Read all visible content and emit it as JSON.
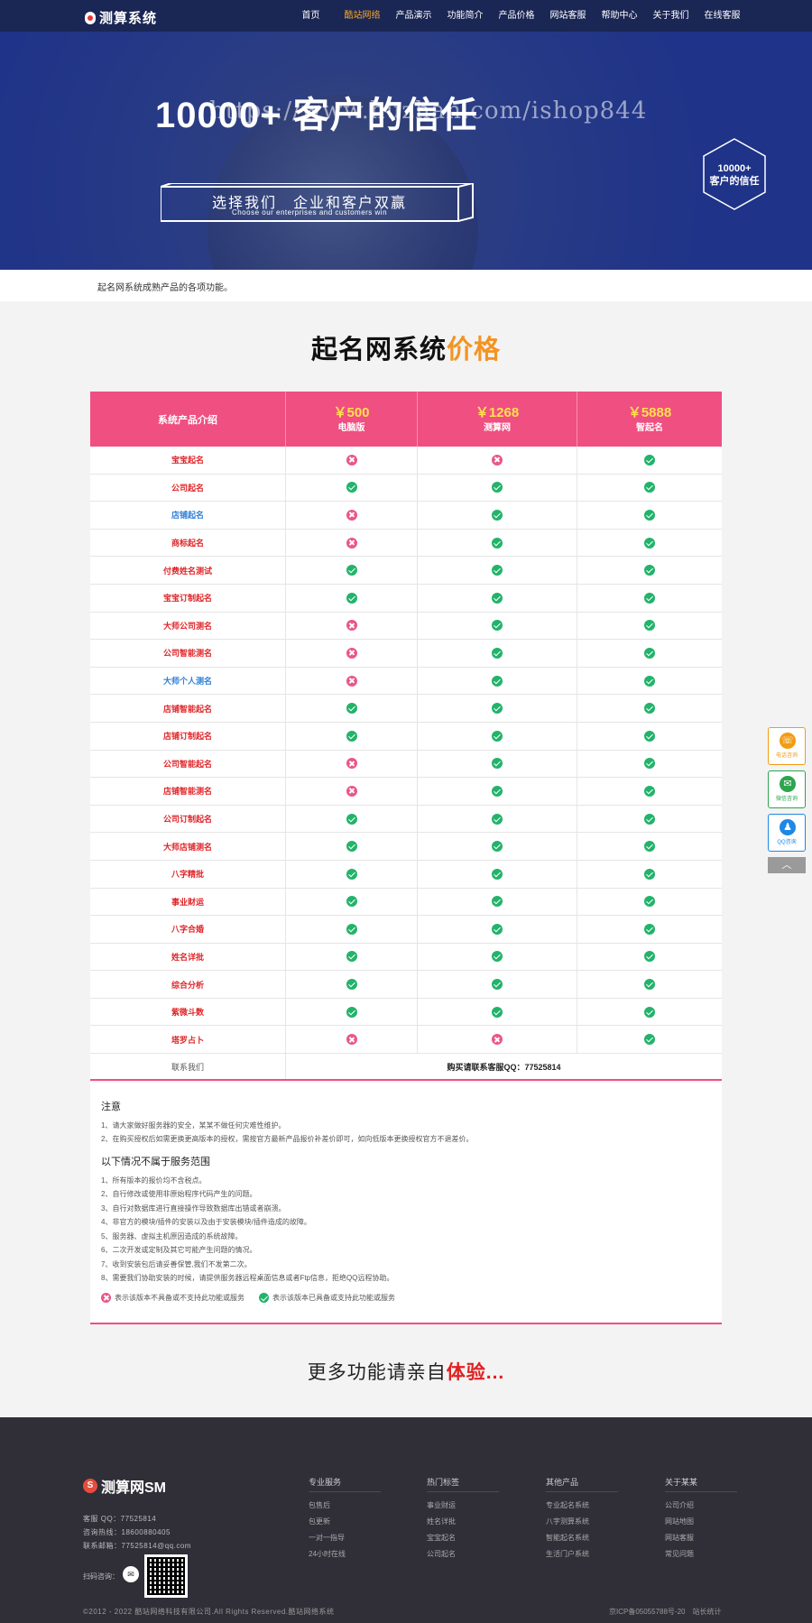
{
  "nav": {
    "logo": "测算系统",
    "items": [
      "首页",
      "酷站网络",
      "产品演示",
      "功能简介",
      "产品价格",
      "网站客服",
      "帮助中心",
      "关于我们",
      "在线客服"
    ],
    "active_index": 1
  },
  "banner": {
    "title": "10000+ 客户的信任",
    "watermark": "https://www.huzhan.com/ishop844",
    "box_main": "选择我们　企业和客户双赢",
    "box_sub": "Choose our enterprises and customers win",
    "hex_line1": "10000+",
    "hex_line2": "客户的信任"
  },
  "strip_text": "起名网系统成熟产品的各项功能。",
  "section_title": {
    "part1": "起名网系统",
    "part2": "价格"
  },
  "table": {
    "header_label": "系统产品介绍",
    "plans": [
      {
        "price": "￥500",
        "name": "电脑版"
      },
      {
        "price": "￥1268",
        "name": "测算网"
      },
      {
        "price": "￥5888",
        "name": "智起名"
      }
    ],
    "rows": [
      {
        "label": "宝宝起名",
        "blue": false,
        "marks": [
          false,
          false,
          true
        ]
      },
      {
        "label": "公司起名",
        "blue": false,
        "marks": [
          true,
          true,
          true
        ]
      },
      {
        "label": "店铺起名",
        "blue": true,
        "marks": [
          false,
          true,
          true
        ]
      },
      {
        "label": "商标起名",
        "blue": false,
        "marks": [
          false,
          true,
          true
        ]
      },
      {
        "label": "付费姓名测试",
        "blue": false,
        "marks": [
          true,
          true,
          true
        ]
      },
      {
        "label": "宝宝订制起名",
        "blue": false,
        "marks": [
          true,
          true,
          true
        ]
      },
      {
        "label": "大师公司测名",
        "blue": false,
        "marks": [
          false,
          true,
          true
        ]
      },
      {
        "label": "公司智能测名",
        "blue": false,
        "marks": [
          false,
          true,
          true
        ]
      },
      {
        "label": "大师个人测名",
        "blue": true,
        "marks": [
          false,
          true,
          true
        ]
      },
      {
        "label": "店铺智能起名",
        "blue": false,
        "marks": [
          true,
          true,
          true
        ]
      },
      {
        "label": "店铺订制起名",
        "blue": false,
        "marks": [
          true,
          true,
          true
        ]
      },
      {
        "label": "公司智能起名",
        "blue": false,
        "marks": [
          false,
          true,
          true
        ]
      },
      {
        "label": "店铺智能测名",
        "blue": false,
        "marks": [
          false,
          true,
          true
        ]
      },
      {
        "label": "公司订制起名",
        "blue": false,
        "marks": [
          true,
          true,
          true
        ]
      },
      {
        "label": "大师店铺测名",
        "blue": false,
        "marks": [
          true,
          true,
          true
        ]
      },
      {
        "label": "八字精批",
        "blue": false,
        "marks": [
          true,
          true,
          true
        ]
      },
      {
        "label": "事业财运",
        "blue": false,
        "marks": [
          true,
          true,
          true
        ]
      },
      {
        "label": "八字合婚",
        "blue": false,
        "marks": [
          true,
          true,
          true
        ]
      },
      {
        "label": "姓名详批",
        "blue": false,
        "marks": [
          true,
          true,
          true
        ]
      },
      {
        "label": "综合分析",
        "blue": false,
        "marks": [
          true,
          true,
          true
        ]
      },
      {
        "label": "紫微斗数",
        "blue": false,
        "marks": [
          true,
          true,
          true
        ]
      },
      {
        "label": "塔罗占卜",
        "blue": false,
        "marks": [
          false,
          false,
          true
        ]
      }
    ],
    "contact_label": "联系我们",
    "contact_qq": "购买请联系客服QQ：77525814"
  },
  "notes": {
    "title1": "注意",
    "items1": [
      "1、请大家做好服务器的安全，某某不做任何灾难性维护。",
      "2、在购买授权后如需更换更高版本的授权，需按官方最新产品报价补差价即可，如向低版本更换授权官方不退差价。"
    ],
    "title2": "以下情况不属于服务范围",
    "items2": [
      "1、所有版本的报价均不含税点。",
      "2、自行修改或使用非原始程序代码产生的问题。",
      "3、自行对数据库进行直接操作导致数据库出错或者崩溃。",
      "4、非官方的模块/插件的安装以及由于安装模块/插件造成的故障。",
      "5、服务器、虚拟主机原因造成的系统故障。",
      "6、二次开发或定制及其它可能产生问题的情况。",
      "7、收到安装包后请妥善保管,我们不发第二次。",
      "8、需要我们协助安装的时候，请提供服务器远程桌面信息或者Ftp信息，拒绝QQ远程协助。"
    ],
    "legend_no": "表示该版本不具备或不支持此功能或服务",
    "legend_yes": "表示该版本已具备或支持此功能或服务"
  },
  "more": {
    "part1": "更多功能请亲自",
    "part2": "体验..."
  },
  "sidebar": {
    "phone": "电话咨询",
    "wechat": "微信咨询",
    "qq": "QQ咨询",
    "top_icon": "chevron-up-icon"
  },
  "footer": {
    "logo": "测算网SM",
    "qq": "客服 QQ：77525814",
    "phone": "咨询热线：18600880405",
    "email": "联系邮箱：77525814@qq.com",
    "scan": "扫码咨询：",
    "columns": [
      {
        "title": "专业服务",
        "items": [
          "包售后",
          "包更新",
          "一对一指导",
          "24小时在线"
        ]
      },
      {
        "title": "热门标签",
        "items": [
          "事业财运",
          "姓名详批",
          "宝宝起名",
          "公司起名"
        ]
      },
      {
        "title": "其他产品",
        "items": [
          "专业起名系统",
          "八字测算系统",
          "智能起名系统",
          "生活门户系统"
        ]
      },
      {
        "title": "关于某某",
        "items": [
          "公司介绍",
          "网站地图",
          "网站客服",
          "常见问题"
        ]
      }
    ],
    "copyright": "©2012 - 2022 酷站网络科技有限公司.All Rights Reserved.酷站网络系统",
    "icp": "京ICP备05055788号-20　站长统计"
  },
  "colors": {
    "nav_bg": "#1a2654",
    "accent_pink": "#ef4f81",
    "price_yellow": "#ffe14a",
    "title_orange": "#f29423",
    "check_green": "#23b36b",
    "cross_pink": "#e8578b",
    "footer_bg": "#302f38"
  }
}
